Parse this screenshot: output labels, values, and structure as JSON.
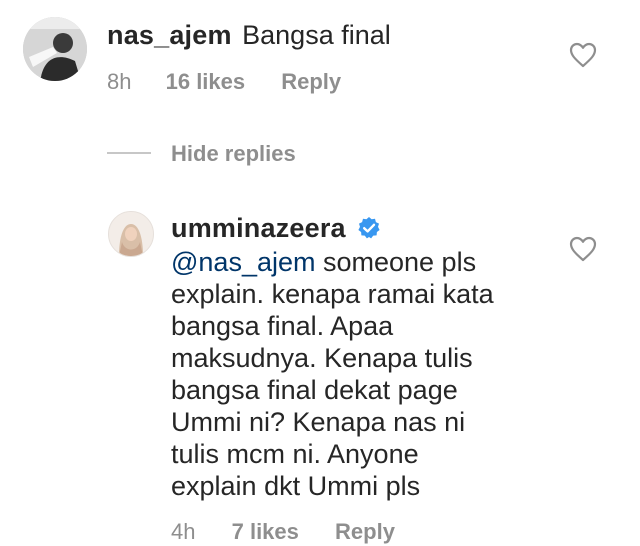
{
  "comments": [
    {
      "username": "nas_ajem",
      "text": "Bangsa final",
      "time": "8h",
      "likes": "16 likes",
      "reply_label": "Reply",
      "avatar_icon": "user-photo-avatar"
    }
  ],
  "hide_replies_label": "Hide replies",
  "reply": {
    "username": "umminazeera",
    "verified_icon": "verified-badge-icon",
    "mention": "@nas_ajem",
    "lines": [
      " someone pls",
      "explain. kenapa ramai kata",
      "bangsa final. Apaa",
      "maksudnya. Kenapa tulis",
      "bangsa final dekat page",
      "Ummi ni? Kenapa nas ni",
      "tulis mcm ni. Anyone",
      "explain dkt Ummi pls"
    ],
    "time": "4h",
    "likes": "7 likes",
    "reply_label": "Reply"
  },
  "colors": {
    "text": "#262626",
    "meta": "#8e8e8e",
    "mention": "#003569",
    "verified": "#3897f0"
  }
}
